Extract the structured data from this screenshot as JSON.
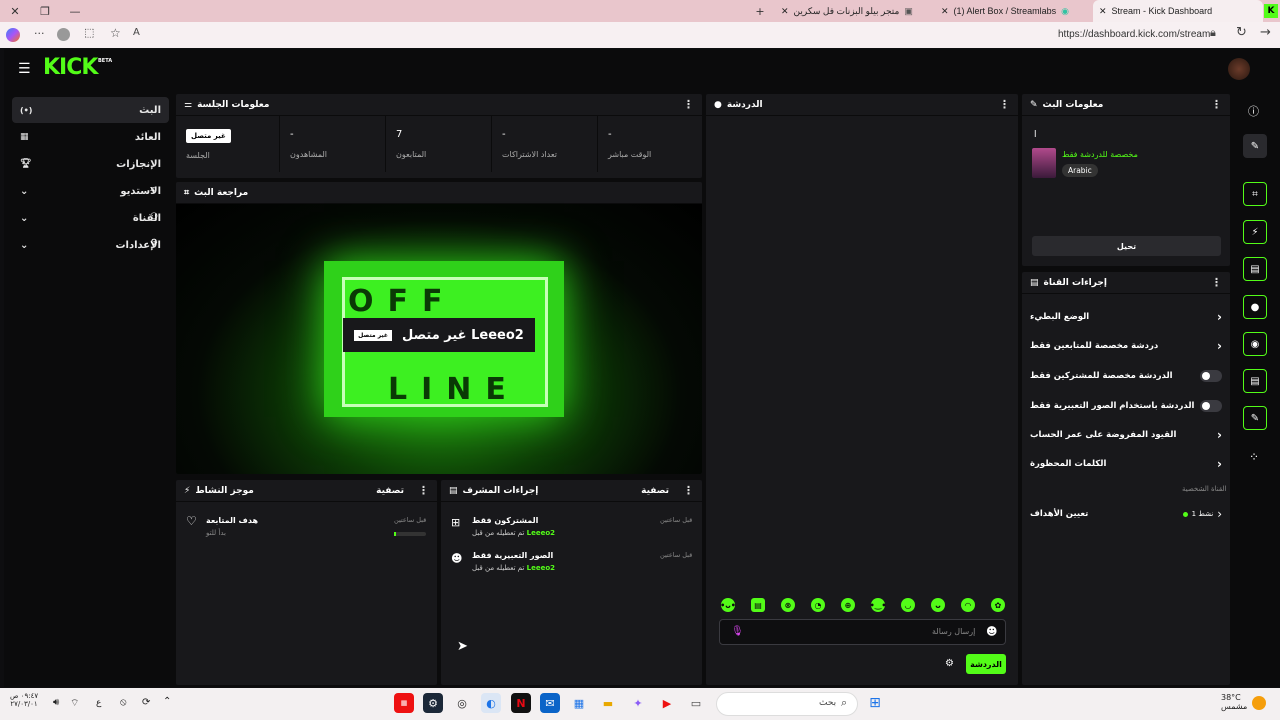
{
  "browser": {
    "tabs": [
      {
        "title": "Stream - Kick Dashboard",
        "active": true
      },
      {
        "title": "(1) Alert Box / Streamlabs",
        "active": false
      },
      {
        "title": "متجر بيلو البزنات فل سكرين",
        "active": false
      }
    ],
    "url": "https://dashboard.kick.com/stream"
  },
  "site": {
    "logo": "KICK",
    "logo_badge": "BETA",
    "sidebar": [
      {
        "label": "البث",
        "icon": "broadcast-icon",
        "active": true
      },
      {
        "label": "العائد",
        "icon": "revenue-icon",
        "active": false
      },
      {
        "label": "الإنجازات",
        "icon": "trophy-icon",
        "active": false
      },
      {
        "label": "الاستديو",
        "icon": "studio-icon",
        "active": false
      },
      {
        "label": "القناة",
        "icon": "channel-icon",
        "active": false
      },
      {
        "label": "الإعدادات",
        "icon": "gear-icon",
        "active": false
      }
    ],
    "session": {
      "title": "معلومات الجلسة",
      "status_badge": "غير متصل",
      "stats": [
        {
          "label": "الجلسة",
          "value": ""
        },
        {
          "label": "المشاهدون",
          "value": "-"
        },
        {
          "label": "المتابعون",
          "value": "7"
        },
        {
          "label": "تعداد الاشتراكات",
          "value": "-"
        },
        {
          "label": "الوقت مباشر",
          "value": "-"
        }
      ]
    },
    "preview": {
      "title": "مراجعة البث",
      "overlay_text": "غير متصل Leeeo2",
      "overlay_badge": "غير متصل",
      "offline_top": "OFF",
      "offline_bottom": "LINE"
    },
    "activity": {
      "title": "موجز النشاط",
      "filter": "تصفية",
      "items": [
        {
          "title": "هدف المتابعة",
          "sub": "بدأ للتو",
          "time": "قبل ساعتين"
        }
      ]
    },
    "mod_actions": {
      "title": "إجراءات المشرف",
      "filter": "تصفية",
      "items": [
        {
          "title": "المشتركون فقط",
          "sub": "تم تعطيله من قبل",
          "user": "Leeeo2",
          "time": "قبل ساعتين"
        },
        {
          "title": "الصور التعبيرية فقط",
          "sub": "تم تعطيله من قبل",
          "user": "Leeeo2",
          "time": "قبل ساعتين"
        }
      ]
    },
    "chat": {
      "title": "الدردشة",
      "placeholder": "إرسال رسالة",
      "send_label": "الدردشة"
    },
    "stream_info": {
      "title": "معلومات البث",
      "stream_title": "ا",
      "category": "مخصصة للدردشة فقط",
      "language": "Arabic",
      "edit_label": "تحيل"
    },
    "channel_actions": {
      "title": "إجراءات القناة",
      "items": [
        {
          "label": "الوضع البطيء",
          "control": "chevron"
        },
        {
          "label": "دردشة مخصصة للمتابعين فقط",
          "control": "chevron"
        },
        {
          "label": "الدردشة مخصصة للمشتركين فقط",
          "control": "toggle"
        },
        {
          "label": "الدردشة باستخدام الصور التعبيرية فقط",
          "control": "toggle"
        },
        {
          "label": "القيود المفروضة على عمر الحساب",
          "control": "chevron"
        },
        {
          "label": "الكلمات المحظورة",
          "control": "chevron"
        }
      ],
      "subheader": "القناة الشخصية",
      "goals_label": "تعيين الأهداف",
      "goals_status": "نشط 1"
    }
  },
  "taskbar": {
    "time": "٠٩:٤٧ ص",
    "date": "٢٧/٠٣/٠١",
    "lang": "ع",
    "search": "بحث",
    "weather_temp": "38°C",
    "weather_desc": "مشمس"
  }
}
